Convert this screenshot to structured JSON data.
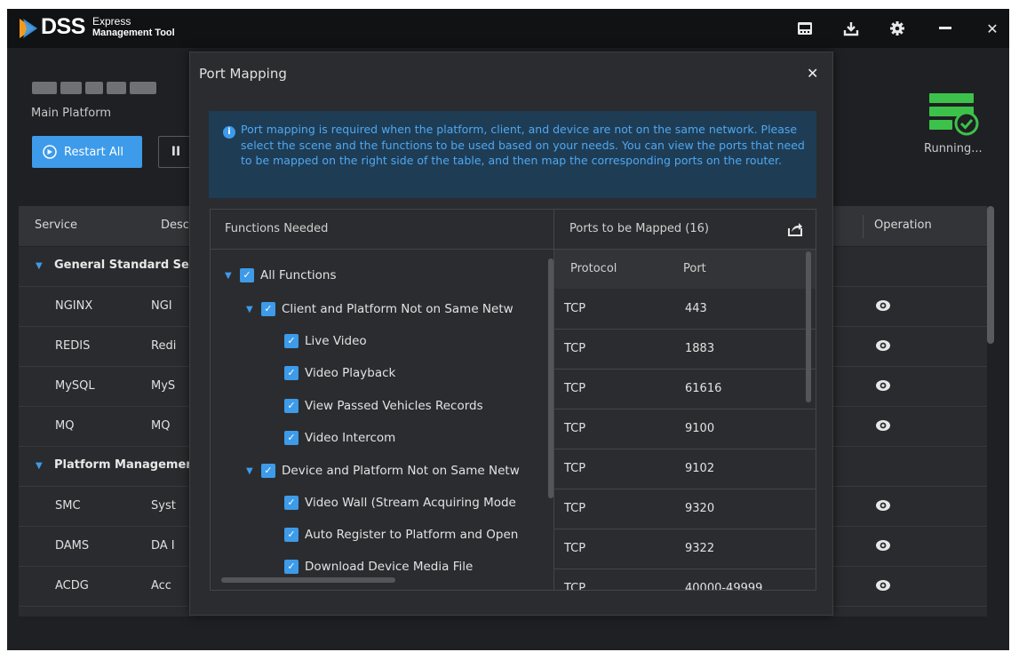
{
  "titlebar": {
    "logo_text": "DSS",
    "logo_sub1": "Express",
    "logo_sub2": "Management Tool",
    "icons": [
      "license-icon",
      "download-icon",
      "settings-gear-icon",
      "minimize-icon",
      "close-icon"
    ],
    "close_glyph": "✕"
  },
  "platform": {
    "name_redacted": true,
    "label": "Main Platform",
    "restart_label": "Restart All",
    "pause_glyph": "II",
    "status_label": "Running..."
  },
  "services": {
    "headers": [
      "Service",
      "Desc",
      "Operation"
    ],
    "rows": [
      {
        "type": "group",
        "label": "General Standard Ser"
      },
      {
        "type": "row",
        "service": "NGINX",
        "desc": "NGI"
      },
      {
        "type": "row",
        "service": "REDIS",
        "desc": "Redi"
      },
      {
        "type": "row",
        "service": "MySQL",
        "desc": "MyS"
      },
      {
        "type": "row",
        "service": "MQ",
        "desc": "MQ"
      },
      {
        "type": "group",
        "label": "Platform Managemen"
      },
      {
        "type": "row",
        "service": "SMC",
        "desc": "Syst"
      },
      {
        "type": "row",
        "service": "DAMS",
        "desc": "DA I"
      },
      {
        "type": "row",
        "service": "ACDG",
        "desc": "Acc"
      }
    ]
  },
  "modal": {
    "title": "Port Mapping",
    "close_glyph": "✕",
    "info_text": "Port mapping is required when the platform, client, and device are not on the same network. Please select the scene and the functions to be used based on your needs. You can view the ports that need to be mapped on the right side of the table, and then map the corresponding ports on the router.",
    "functions_header": "Functions Needed",
    "tree": [
      {
        "label": "All Functions",
        "level": 0,
        "expander": true
      },
      {
        "label": "Client and Platform Not on Same Netw",
        "level": 1,
        "expander": true
      },
      {
        "label": "Live Video",
        "level": 2,
        "expander": false
      },
      {
        "label": "Video Playback",
        "level": 2,
        "expander": false
      },
      {
        "label": "View Passed Vehicles Records",
        "level": 2,
        "expander": false
      },
      {
        "label": "Video Intercom",
        "level": 2,
        "expander": false
      },
      {
        "label": "Device and Platform Not on Same Netw",
        "level": 1,
        "expander": true
      },
      {
        "label": "Video Wall (Stream Acquiring Mode",
        "level": 2,
        "expander": false
      },
      {
        "label": "Auto Register to Platform and Open",
        "level": 2,
        "expander": false
      },
      {
        "label": "Download Device Media File",
        "level": 2,
        "expander": false
      }
    ],
    "ports_header": "Ports to be Mapped (16)",
    "ports_columns": [
      "Protocol",
      "Port"
    ],
    "ports": [
      {
        "protocol": "TCP",
        "port": "443"
      },
      {
        "protocol": "TCP",
        "port": "1883"
      },
      {
        "protocol": "TCP",
        "port": "61616"
      },
      {
        "protocol": "TCP",
        "port": "9100"
      },
      {
        "protocol": "TCP",
        "port": "9102"
      },
      {
        "protocol": "TCP",
        "port": "9320"
      },
      {
        "protocol": "TCP",
        "port": "9322"
      },
      {
        "protocol": "TCP",
        "port": "40000-49999"
      }
    ]
  },
  "colors": {
    "accent": "#3d9be9",
    "info_bg": "#1f3c55",
    "running_green": "#3cc24a"
  }
}
